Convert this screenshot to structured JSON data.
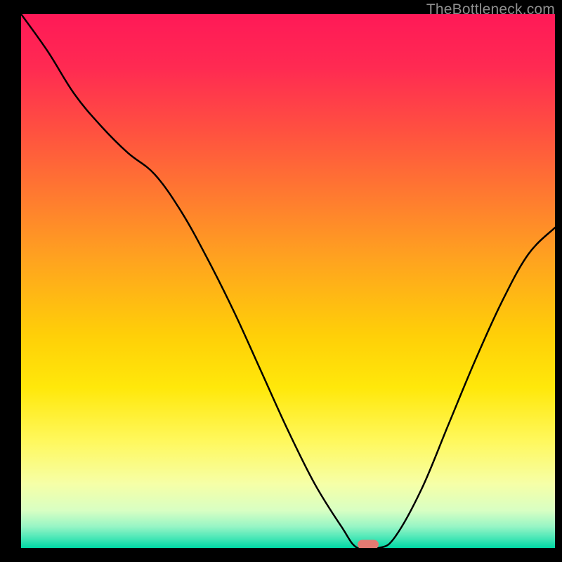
{
  "watermark": "TheBottleneck.com",
  "chart_data": {
    "type": "line",
    "title": "",
    "xlabel": "",
    "ylabel": "",
    "xlim": [
      0,
      100
    ],
    "ylim": [
      0,
      100
    ],
    "x": [
      0,
      5,
      10,
      15,
      20,
      25,
      30,
      35,
      40,
      45,
      50,
      55,
      60,
      63,
      67,
      70,
      75,
      80,
      85,
      90,
      95,
      100
    ],
    "values": [
      100,
      93,
      85,
      79,
      74,
      70,
      63,
      54,
      44,
      33,
      22,
      12,
      4,
      0,
      0,
      2,
      11,
      23,
      35,
      46,
      55,
      60
    ],
    "marker": {
      "x": 65,
      "y": 0
    },
    "gradient_colors": {
      "top": "#ff1957",
      "upper_mid": "#ff7a30",
      "mid": "#ffe80a",
      "lower": "#00d9a5"
    }
  }
}
